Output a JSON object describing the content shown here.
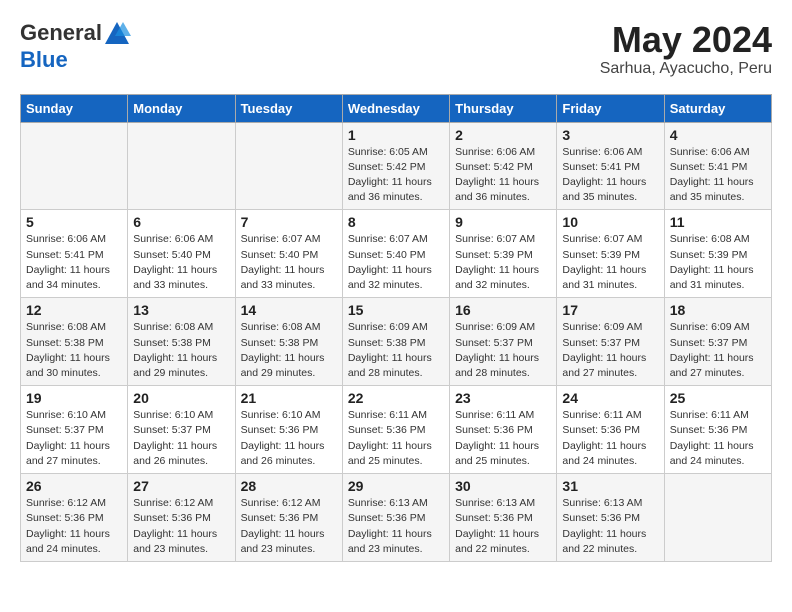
{
  "header": {
    "logo_general": "General",
    "logo_blue": "Blue",
    "month_title": "May 2024",
    "subtitle": "Sarhua, Ayacucho, Peru"
  },
  "weekdays": [
    "Sunday",
    "Monday",
    "Tuesday",
    "Wednesday",
    "Thursday",
    "Friday",
    "Saturday"
  ],
  "weeks": [
    [
      {
        "day": "",
        "info": ""
      },
      {
        "day": "",
        "info": ""
      },
      {
        "day": "",
        "info": ""
      },
      {
        "day": "1",
        "info": "Sunrise: 6:05 AM\nSunset: 5:42 PM\nDaylight: 11 hours\nand 36 minutes."
      },
      {
        "day": "2",
        "info": "Sunrise: 6:06 AM\nSunset: 5:42 PM\nDaylight: 11 hours\nand 36 minutes."
      },
      {
        "day": "3",
        "info": "Sunrise: 6:06 AM\nSunset: 5:41 PM\nDaylight: 11 hours\nand 35 minutes."
      },
      {
        "day": "4",
        "info": "Sunrise: 6:06 AM\nSunset: 5:41 PM\nDaylight: 11 hours\nand 35 minutes."
      }
    ],
    [
      {
        "day": "5",
        "info": "Sunrise: 6:06 AM\nSunset: 5:41 PM\nDaylight: 11 hours\nand 34 minutes."
      },
      {
        "day": "6",
        "info": "Sunrise: 6:06 AM\nSunset: 5:40 PM\nDaylight: 11 hours\nand 33 minutes."
      },
      {
        "day": "7",
        "info": "Sunrise: 6:07 AM\nSunset: 5:40 PM\nDaylight: 11 hours\nand 33 minutes."
      },
      {
        "day": "8",
        "info": "Sunrise: 6:07 AM\nSunset: 5:40 PM\nDaylight: 11 hours\nand 32 minutes."
      },
      {
        "day": "9",
        "info": "Sunrise: 6:07 AM\nSunset: 5:39 PM\nDaylight: 11 hours\nand 32 minutes."
      },
      {
        "day": "10",
        "info": "Sunrise: 6:07 AM\nSunset: 5:39 PM\nDaylight: 11 hours\nand 31 minutes."
      },
      {
        "day": "11",
        "info": "Sunrise: 6:08 AM\nSunset: 5:39 PM\nDaylight: 11 hours\nand 31 minutes."
      }
    ],
    [
      {
        "day": "12",
        "info": "Sunrise: 6:08 AM\nSunset: 5:38 PM\nDaylight: 11 hours\nand 30 minutes."
      },
      {
        "day": "13",
        "info": "Sunrise: 6:08 AM\nSunset: 5:38 PM\nDaylight: 11 hours\nand 29 minutes."
      },
      {
        "day": "14",
        "info": "Sunrise: 6:08 AM\nSunset: 5:38 PM\nDaylight: 11 hours\nand 29 minutes."
      },
      {
        "day": "15",
        "info": "Sunrise: 6:09 AM\nSunset: 5:38 PM\nDaylight: 11 hours\nand 28 minutes."
      },
      {
        "day": "16",
        "info": "Sunrise: 6:09 AM\nSunset: 5:37 PM\nDaylight: 11 hours\nand 28 minutes."
      },
      {
        "day": "17",
        "info": "Sunrise: 6:09 AM\nSunset: 5:37 PM\nDaylight: 11 hours\nand 27 minutes."
      },
      {
        "day": "18",
        "info": "Sunrise: 6:09 AM\nSunset: 5:37 PM\nDaylight: 11 hours\nand 27 minutes."
      }
    ],
    [
      {
        "day": "19",
        "info": "Sunrise: 6:10 AM\nSunset: 5:37 PM\nDaylight: 11 hours\nand 27 minutes."
      },
      {
        "day": "20",
        "info": "Sunrise: 6:10 AM\nSunset: 5:37 PM\nDaylight: 11 hours\nand 26 minutes."
      },
      {
        "day": "21",
        "info": "Sunrise: 6:10 AM\nSunset: 5:36 PM\nDaylight: 11 hours\nand 26 minutes."
      },
      {
        "day": "22",
        "info": "Sunrise: 6:11 AM\nSunset: 5:36 PM\nDaylight: 11 hours\nand 25 minutes."
      },
      {
        "day": "23",
        "info": "Sunrise: 6:11 AM\nSunset: 5:36 PM\nDaylight: 11 hours\nand 25 minutes."
      },
      {
        "day": "24",
        "info": "Sunrise: 6:11 AM\nSunset: 5:36 PM\nDaylight: 11 hours\nand 24 minutes."
      },
      {
        "day": "25",
        "info": "Sunrise: 6:11 AM\nSunset: 5:36 PM\nDaylight: 11 hours\nand 24 minutes."
      }
    ],
    [
      {
        "day": "26",
        "info": "Sunrise: 6:12 AM\nSunset: 5:36 PM\nDaylight: 11 hours\nand 24 minutes."
      },
      {
        "day": "27",
        "info": "Sunrise: 6:12 AM\nSunset: 5:36 PM\nDaylight: 11 hours\nand 23 minutes."
      },
      {
        "day": "28",
        "info": "Sunrise: 6:12 AM\nSunset: 5:36 PM\nDaylight: 11 hours\nand 23 minutes."
      },
      {
        "day": "29",
        "info": "Sunrise: 6:13 AM\nSunset: 5:36 PM\nDaylight: 11 hours\nand 23 minutes."
      },
      {
        "day": "30",
        "info": "Sunrise: 6:13 AM\nSunset: 5:36 PM\nDaylight: 11 hours\nand 22 minutes."
      },
      {
        "day": "31",
        "info": "Sunrise: 6:13 AM\nSunset: 5:36 PM\nDaylight: 11 hours\nand 22 minutes."
      },
      {
        "day": "",
        "info": ""
      }
    ]
  ]
}
